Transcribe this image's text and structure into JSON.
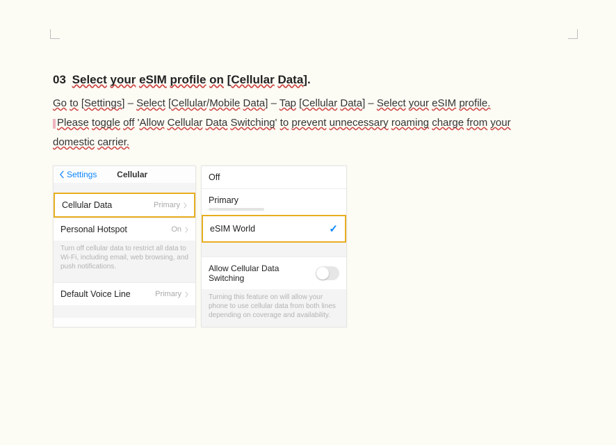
{
  "step": {
    "number": "03",
    "title_parts": [
      "Select",
      " ",
      "your",
      " ",
      "eSIM",
      " ",
      "profile",
      " ",
      "on",
      " [",
      "Cellular",
      " ",
      "Data",
      "]."
    ]
  },
  "line1_parts": [
    "Go",
    " ",
    "to",
    " [",
    "Settings",
    "] – ",
    "Select",
    " [",
    "Cellular",
    "/",
    "Mobile",
    " ",
    "Data",
    "] – ",
    "Tap",
    " [",
    "Cellular",
    " ",
    "Data",
    "] – ",
    "Select",
    " ",
    "your",
    " ",
    "eSIM",
    " ",
    "profile."
  ],
  "line2_parts": [
    "Please",
    " ",
    "toggle",
    " ",
    "off",
    " '",
    "Allow",
    " ",
    "Cellular",
    " ",
    "Data",
    " ",
    "Switching",
    "' ",
    "to",
    " ",
    "prevent",
    " ",
    "unnecessary",
    " ",
    "roaming",
    " ",
    "charge",
    " ",
    "from",
    " ",
    "your"
  ],
  "line3_parts": [
    "domestic",
    " ",
    "carrier."
  ],
  "left_panel": {
    "back": "Settings",
    "title": "Cellular",
    "row_cellular_data": "Cellular Data",
    "row_cellular_data_sub": "Primary",
    "row_hotspot": "Personal Hotspot",
    "row_hotspot_sub": "On",
    "note": "Turn off cellular data to restrict all data to Wi-Fi, including email, web browsing, and push notifications.",
    "row_voice": "Default Voice Line",
    "row_voice_sub": "Primary"
  },
  "right_panel": {
    "off": "Off",
    "primary": "Primary",
    "esim": "eSIM World",
    "switch_label": "Allow Cellular Data Switching",
    "switch_note": "Turning this feature on will allow your phone to use cellular data from both lines depending on coverage and availability."
  }
}
